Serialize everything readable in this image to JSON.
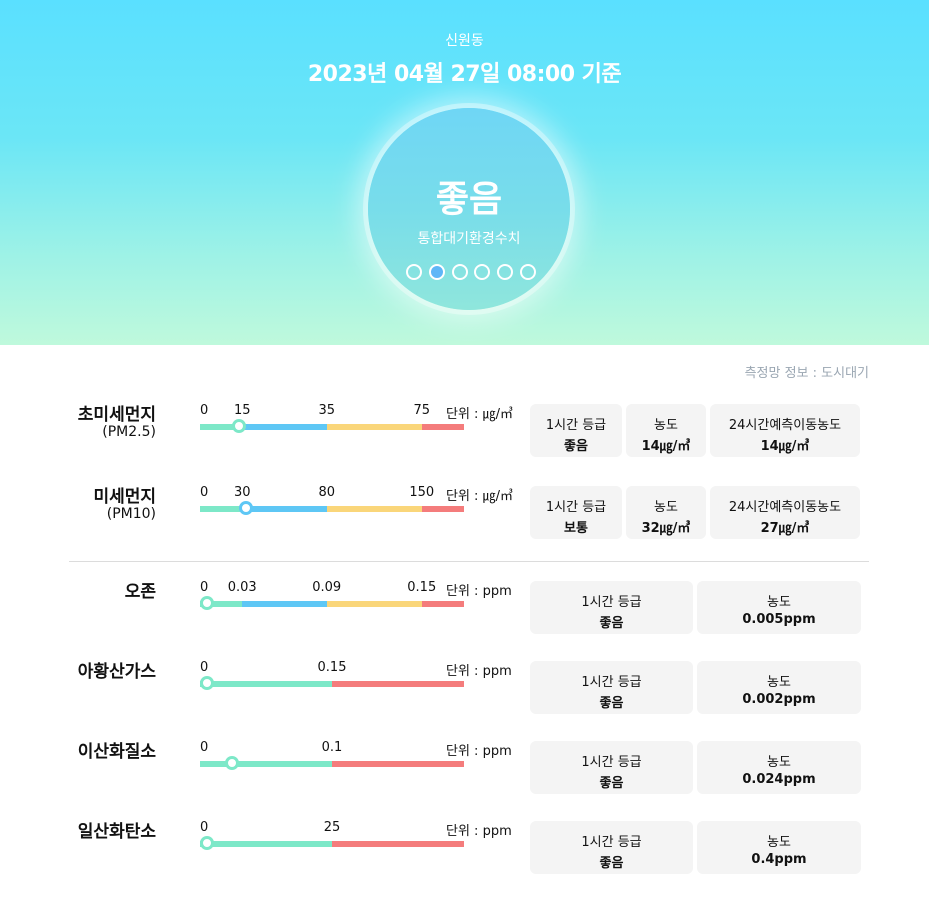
{
  "header": {
    "location": "신원동",
    "datetime": "2023년 04월 27일 08:00 기준",
    "grade": "좋음",
    "index_label": "통합대기환경수치",
    "page_count": 6,
    "active_page": 2
  },
  "network_info": "측정망 정보 : 도시대기",
  "colors": {
    "good": "#7de8c8",
    "normal": "#5ec7f5",
    "bad": "#fad67a",
    "very_bad": "#f47c7c"
  },
  "pollutants": [
    {
      "name": "초미세먼지",
      "sub": "(PM2.5)",
      "ticks": [
        "0",
        "15",
        "35",
        "75"
      ],
      "unit": "단위 : ㎍/㎥",
      "thresholds": [
        0,
        15,
        35,
        75
      ],
      "max": 100,
      "value": 14,
      "cards": [
        {
          "label": "1시간 등급",
          "value": "좋음"
        },
        {
          "label": "농도",
          "value": "14㎍/㎥"
        },
        {
          "label": "24시간예측이동농도",
          "value": "14㎍/㎥"
        }
      ]
    },
    {
      "name": "미세먼지",
      "sub": "(PM10)",
      "ticks": [
        "0",
        "30",
        "80",
        "150"
      ],
      "unit": "단위 : ㎍/㎥",
      "thresholds": [
        0,
        30,
        80,
        150
      ],
      "max": 200,
      "value": 32,
      "cards": [
        {
          "label": "1시간 등급",
          "value": "보통"
        },
        {
          "label": "농도",
          "value": "32㎍/㎥"
        },
        {
          "label": "24시간예측이동농도",
          "value": "27㎍/㎥"
        }
      ]
    },
    {
      "name": "오존",
      "sub": "",
      "ticks": [
        "0",
        "0.03",
        "0.09",
        "0.15"
      ],
      "unit": "단위 : ppm",
      "thresholds": [
        0,
        0.03,
        0.09,
        0.15
      ],
      "max": 0.18,
      "value": 0.005,
      "cards": [
        {
          "label": "1시간 등급",
          "value": "좋음"
        },
        {
          "label": "농도",
          "value": "0.005ppm"
        }
      ]
    },
    {
      "name": "아황산가스",
      "sub": "",
      "ticks": [
        "0",
        "0.15"
      ],
      "unit": "단위 : ppm",
      "thresholds": [
        0,
        0.15
      ],
      "max": 0.3,
      "value": 0.002,
      "cards": [
        {
          "label": "1시간 등급",
          "value": "좋음"
        },
        {
          "label": "농도",
          "value": "0.002ppm"
        }
      ]
    },
    {
      "name": "이산화질소",
      "sub": "",
      "ticks": [
        "0",
        "0.1"
      ],
      "unit": "단위 : ppm",
      "thresholds": [
        0,
        0.1
      ],
      "max": 0.2,
      "value": 0.024,
      "cards": [
        {
          "label": "1시간 등급",
          "value": "좋음"
        },
        {
          "label": "농도",
          "value": "0.024ppm"
        }
      ]
    },
    {
      "name": "일산화탄소",
      "sub": "",
      "ticks": [
        "0",
        "25"
      ],
      "unit": "단위 : ppm",
      "thresholds": [
        0,
        25
      ],
      "max": 50,
      "value": 0.4,
      "cards": [
        {
          "label": "1시간 등급",
          "value": "좋음"
        },
        {
          "label": "농도",
          "value": "0.4ppm"
        }
      ]
    }
  ]
}
